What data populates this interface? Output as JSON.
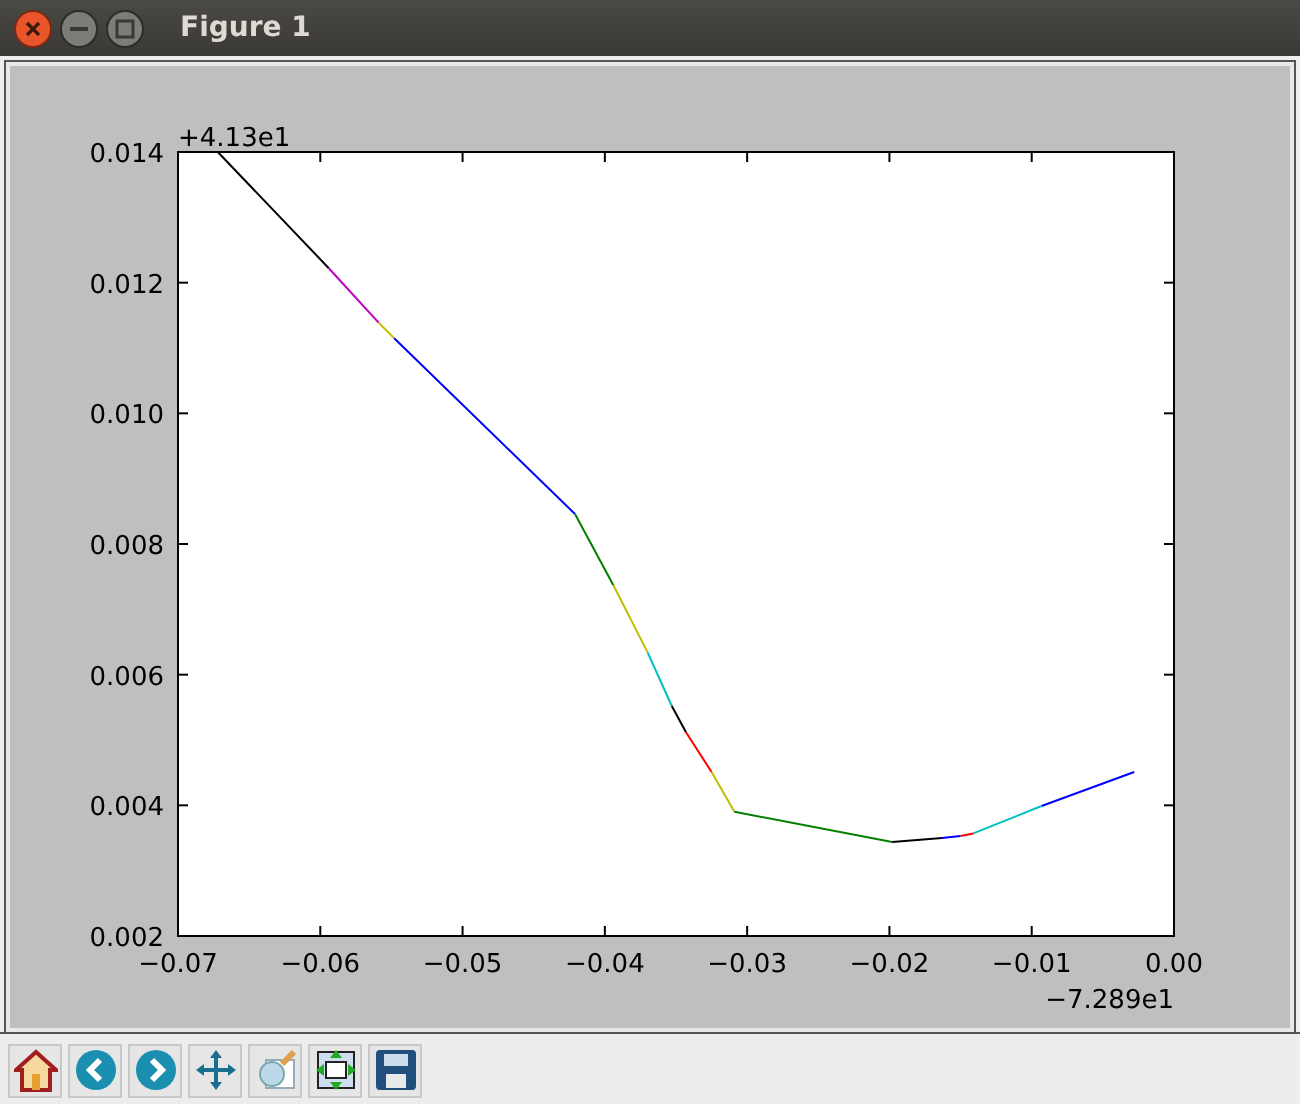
{
  "window": {
    "title": "Figure 1"
  },
  "figure": {
    "chart_data": {
      "type": "line",
      "xlim": [
        -0.07,
        0.0
      ],
      "ylim": [
        0.002,
        0.014
      ],
      "xticks": [
        {
          "value": -0.07,
          "label": "−0.07"
        },
        {
          "value": -0.06,
          "label": "−0.06"
        },
        {
          "value": -0.05,
          "label": "−0.05"
        },
        {
          "value": -0.04,
          "label": "−0.04"
        },
        {
          "value": -0.03,
          "label": "−0.03"
        },
        {
          "value": -0.02,
          "label": "−0.02"
        },
        {
          "value": -0.01,
          "label": "−0.01"
        },
        {
          "value": 0.0,
          "label": "0.00"
        }
      ],
      "yticks": [
        {
          "value": 0.002,
          "label": "0.002"
        },
        {
          "value": 0.004,
          "label": "0.004"
        },
        {
          "value": 0.006,
          "label": "0.006"
        },
        {
          "value": 0.008,
          "label": "0.008"
        },
        {
          "value": 0.01,
          "label": "0.010"
        },
        {
          "value": 0.012,
          "label": "0.012"
        },
        {
          "value": 0.014,
          "label": "0.014"
        }
      ],
      "annotations": [
        "−7.289e1",
        "+4.13e1"
      ],
      "series": [
        {
          "color": "#000000",
          "x": [
            -0.0672,
            -0.0594
          ],
          "values": [
            0.014,
            0.01222
          ]
        },
        {
          "color": "#bf00bf",
          "x": [
            -0.0594,
            -0.0559
          ],
          "values": [
            0.01222,
            0.01139
          ]
        },
        {
          "color": "#bfbf00",
          "x": [
            -0.0559,
            -0.0548
          ],
          "values": [
            0.01139,
            0.01115
          ]
        },
        {
          "color": "#0000ff",
          "x": [
            -0.0548,
            -0.0421
          ],
          "values": [
            0.01115,
            0.00846
          ]
        },
        {
          "color": "#008000",
          "x": [
            -0.0421,
            -0.0394
          ],
          "values": [
            0.00846,
            0.00737
          ]
        },
        {
          "color": "#bfbf00",
          "x": [
            -0.0394,
            -0.037
          ],
          "values": [
            0.00737,
            0.00634
          ]
        },
        {
          "color": "#00bfbf",
          "x": [
            -0.037,
            -0.0353
          ],
          "values": [
            0.00634,
            0.00552
          ]
        },
        {
          "color": "#000000",
          "x": [
            -0.0353,
            -0.0343
          ],
          "values": [
            0.00552,
            0.00512
          ]
        },
        {
          "color": "#ff0000",
          "x": [
            -0.0343,
            -0.0325
          ],
          "values": [
            0.00512,
            0.00451
          ]
        },
        {
          "color": "#bfbf00",
          "x": [
            -0.0325,
            -0.0309
          ],
          "values": [
            0.00451,
            0.0039
          ]
        },
        {
          "color": "#008000",
          "x": [
            -0.0309,
            -0.0198
          ],
          "values": [
            0.0039,
            0.00344
          ]
        },
        {
          "color": "#000000",
          "x": [
            -0.0198,
            -0.0163
          ],
          "values": [
            0.00344,
            0.0035
          ]
        },
        {
          "color": "#0000ff",
          "x": [
            -0.0163,
            -0.015
          ],
          "values": [
            0.0035,
            0.00353
          ]
        },
        {
          "color": "#ff0000",
          "x": [
            -0.015,
            -0.0141
          ],
          "values": [
            0.00353,
            0.00357
          ]
        },
        {
          "color": "#00bfbf",
          "x": [
            -0.0141,
            -0.0093
          ],
          "values": [
            0.00357,
            0.00399
          ]
        },
        {
          "color": "#0000ff",
          "x": [
            -0.0093,
            -0.0028
          ],
          "values": [
            0.00399,
            0.00451
          ]
        }
      ]
    }
  }
}
